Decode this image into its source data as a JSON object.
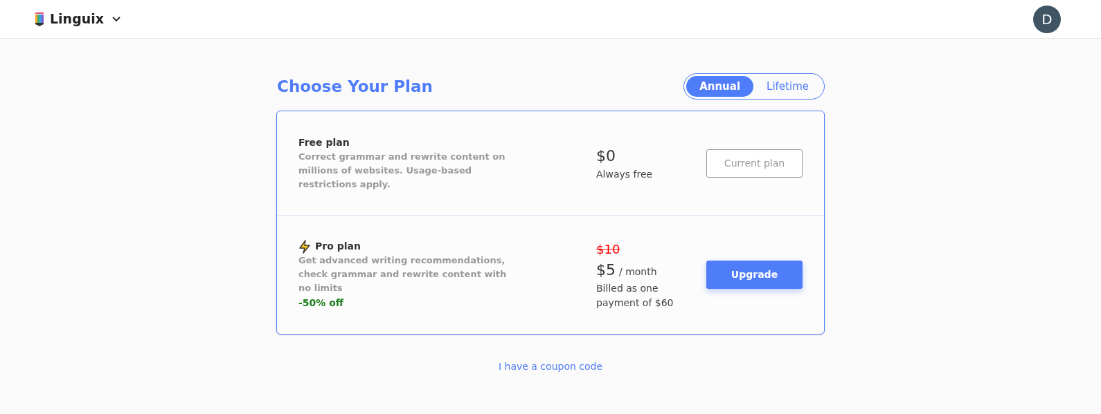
{
  "header": {
    "brand": "Linguix",
    "avatar": "D"
  },
  "title": "Choose Your Plan",
  "billing_tabs": [
    {
      "label": "Annual",
      "selected": true
    },
    {
      "label": "Lifetime",
      "selected": false
    }
  ],
  "plans": [
    {
      "kind": "free",
      "name": "Free plan",
      "description": "Correct grammar and rewrite content on millions of websites. Usage-based restrictions apply.",
      "price": "$0",
      "price_note": "Always free",
      "button": "Current plan"
    },
    {
      "kind": "pro",
      "name": "Pro plan",
      "description": "Get advanced writing recommendations, check grammar and rewrite content with no limits",
      "discount": "-50% off",
      "old_price": "$10",
      "price": "$5",
      "period": "/ month",
      "price_note": "Billed as one payment of $60",
      "button": "Upgrade"
    }
  ],
  "coupon_link": "I have a coupon code"
}
